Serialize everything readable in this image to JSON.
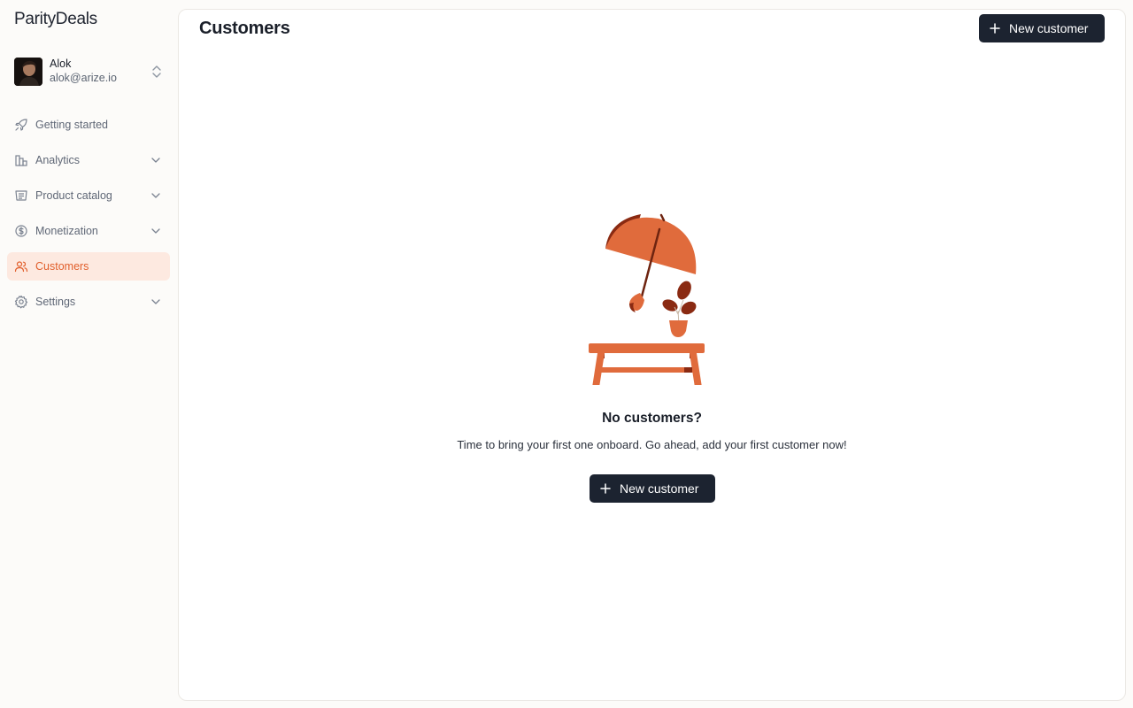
{
  "app": {
    "logo": "ParityDeals"
  },
  "user": {
    "name": "Alok",
    "email": "alok@arize.io"
  },
  "nav": [
    {
      "label": "Getting started",
      "icon": "rocket-icon",
      "expandable": false,
      "active": false
    },
    {
      "label": "Analytics",
      "icon": "bar-chart-icon",
      "expandable": true,
      "active": false
    },
    {
      "label": "Product catalog",
      "icon": "catalog-icon",
      "expandable": true,
      "active": false
    },
    {
      "label": "Monetization",
      "icon": "coin-icon",
      "expandable": true,
      "active": false
    },
    {
      "label": "Customers",
      "icon": "users-icon",
      "expandable": false,
      "active": true
    },
    {
      "label": "Settings",
      "icon": "gear-icon",
      "expandable": true,
      "active": false
    }
  ],
  "page": {
    "title": "Customers",
    "new_button_label": "New customer"
  },
  "empty_state": {
    "title": "No customers?",
    "description": "Time to bring your first one onboard. Go ahead, add your first customer now!",
    "button_label": "New customer"
  },
  "colors": {
    "accent": "#e15f2c",
    "active_bg": "#fde9e0",
    "button_bg": "#1c2330",
    "illustration_orange": "#e06b3c",
    "illustration_brown": "#8a2a12"
  }
}
